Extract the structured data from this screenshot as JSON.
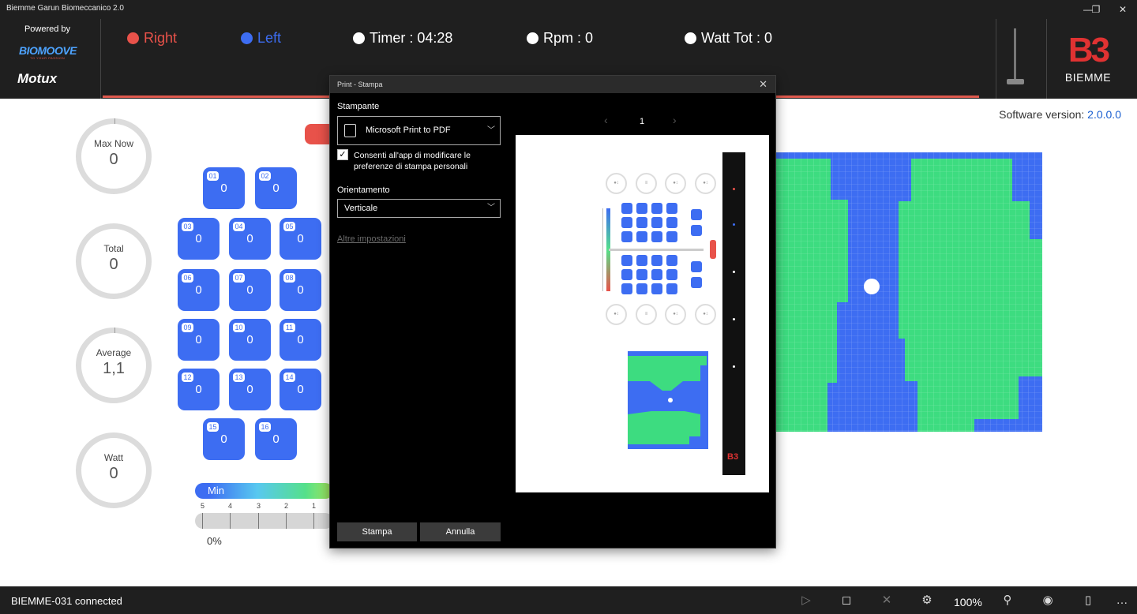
{
  "window": {
    "title": "Biemme Garun Biomeccanico 2.0",
    "controls": {
      "minimize": "—",
      "maximize": "❐",
      "close": "✕"
    }
  },
  "header": {
    "powered_by": "Powered by",
    "partner_logo": "BIOMOOVE",
    "partner_tagline": "TO YOUR PASSION",
    "second_logo": "Motux",
    "brand_mark": "B3",
    "brand_name": "BIEMME",
    "metrics": [
      {
        "label": "Right",
        "color": "#e8524a"
      },
      {
        "label": "Left",
        "color": "#3d6df2"
      },
      {
        "label": "Timer : 04:28",
        "color": "#ffffff"
      },
      {
        "label": "Rpm : 0",
        "color": "#ffffff"
      },
      {
        "label": "Watt Tot : 0",
        "color": "#ffffff"
      }
    ]
  },
  "software_version": {
    "label": "Software version: ",
    "value": "2.0.0.0"
  },
  "gauges": [
    {
      "label": "Max Now",
      "value": "0"
    },
    {
      "label": "Total",
      "value": "0"
    },
    {
      "label": "Average",
      "value": "1,1"
    },
    {
      "label": "Watt",
      "value": "0"
    }
  ],
  "sensors": [
    {
      "id": "01",
      "value": "0"
    },
    {
      "id": "02",
      "value": "0"
    },
    {
      "id": "03",
      "value": "0"
    },
    {
      "id": "04",
      "value": "0"
    },
    {
      "id": "05",
      "value": "0"
    },
    {
      "id": "06",
      "value": "0"
    },
    {
      "id": "07",
      "value": "0"
    },
    {
      "id": "08",
      "value": "0"
    },
    {
      "id": "09",
      "value": "0"
    },
    {
      "id": "10",
      "value": "0"
    },
    {
      "id": "11",
      "value": "0"
    },
    {
      "id": "12",
      "value": "0"
    },
    {
      "id": "13",
      "value": "0"
    },
    {
      "id": "14",
      "value": "0"
    },
    {
      "id": "15",
      "value": "0"
    },
    {
      "id": "16",
      "value": "0"
    }
  ],
  "scale": {
    "min_label": "Min",
    "ticks": [
      "5",
      "4",
      "3",
      "2",
      "1"
    ],
    "percent": "0%"
  },
  "status_bar": {
    "connection": "BIEMME-031 connected",
    "zoom": "100%",
    "icons": [
      "play-icon",
      "stop-icon",
      "close-icon",
      "settings-icon",
      "zoom-icon",
      "view-icon",
      "document-icon",
      "more-icon"
    ]
  },
  "print_dialog": {
    "title": "Print - Stampa",
    "printer_label": "Stampante",
    "printer_value": "Microsoft Print to PDF",
    "allow_app_text": "Consenti all'app di modificare le preferenze di stampa personali",
    "allow_app_checked": true,
    "orientation_label": "Orientamento",
    "orientation_value": "Verticale",
    "more_settings": "Altre impostazioni",
    "page_number": "1",
    "prev_glyph": "‹",
    "next_glyph": "›",
    "print_button": "Stampa",
    "cancel_button": "Annulla"
  },
  "colors": {
    "right": "#e8524a",
    "left": "#3d6df2",
    "sensor": "#3d6df2",
    "map_low": "#3d6df2",
    "map_mid": "#3ddc80",
    "link": "#1a5fd0",
    "chrome": "#1f1f1f"
  }
}
